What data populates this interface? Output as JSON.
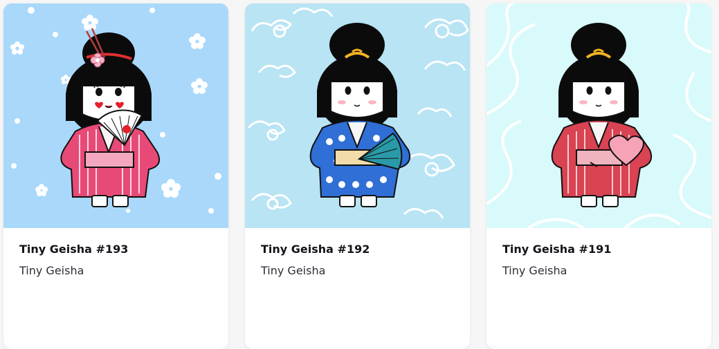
{
  "cards": [
    {
      "title": "Tiny Geisha #193",
      "collection": "Tiny Geisha",
      "background": "#a9d8fb",
      "background_pattern": "sakura-flowers",
      "kimono_color": "#e84a78",
      "sash_color": "#f3a8c0",
      "hair_ornament": "pink-flower-with-sticks",
      "held_item": "white-red-folding-fan",
      "cheeks": "red-hearts"
    },
    {
      "title": "Tiny Geisha #192",
      "collection": "Tiny Geisha",
      "background": "#b8e4f4",
      "background_pattern": "white-swirl-clouds",
      "kimono_color": "#2f6fd6",
      "sash_color": "#f1dcaa",
      "hair_ornament": "gold-comb",
      "held_item": "teal-folding-fan",
      "cheeks": "pink-blush"
    },
    {
      "title": "Tiny Geisha #191",
      "collection": "Tiny Geisha",
      "background": "#d9fafa",
      "background_pattern": "white-wavy-lines",
      "kimono_color": "#d94352",
      "sash_color": "#f0b4bf",
      "hair_ornament": "gold-comb",
      "held_item": "pink-heart-fan",
      "cheeks": "pink-blush"
    }
  ]
}
